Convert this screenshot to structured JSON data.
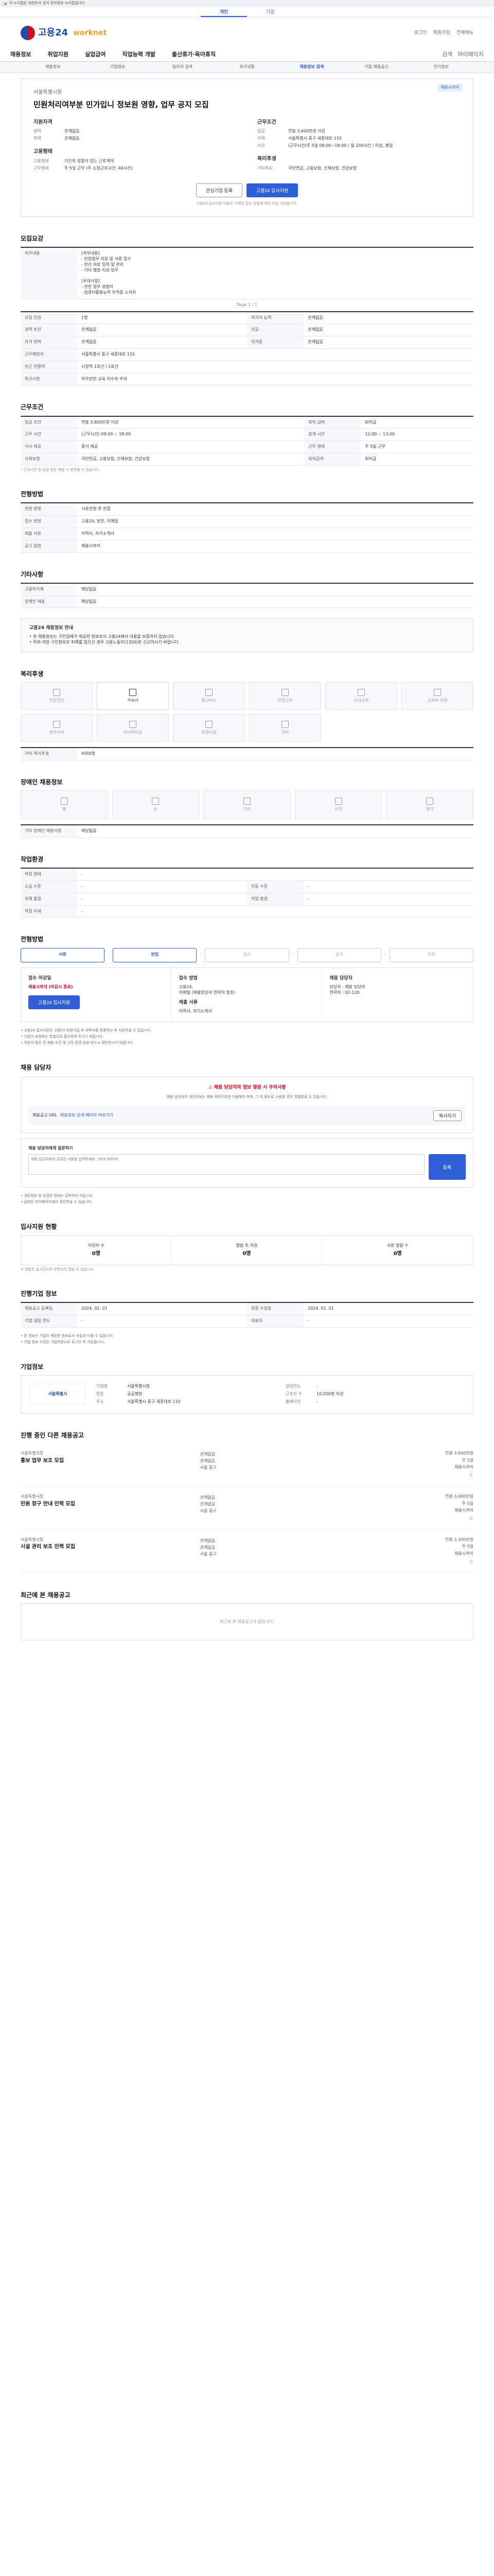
{
  "gov_banner": "이 누리집은 대한민국 공식 전자정부 누리집입니다.",
  "top_tabs": [
    "개인",
    "기업"
  ],
  "logo": {
    "main": "고용24",
    "sub": "worknet"
  },
  "util": [
    "로그인",
    "회원가입",
    "전체메뉴"
  ],
  "gnb": [
    "채용정보",
    "취업지원",
    "실업급여",
    "직업능력 개발",
    "출산휴가·육아휴직"
  ],
  "gnb_right": [
    "검색",
    "마이페이지"
  ],
  "subnav": [
    "채용정보",
    "기업정보",
    "일자리 검색",
    "워크넷통",
    "채용정보 검색",
    "기업 채용공고",
    "인기정보"
  ],
  "posting": {
    "badge": "채용시까지",
    "org": "서울특별시청",
    "title": "민원처리여부분 민가입니 정보원 영향, 업무 공지 모집",
    "sections": {
      "left": [
        {
          "title": "지원자격",
          "rows": [
            [
              "경력",
              "관계없음"
            ],
            [
              "학력",
              "관계없음"
            ]
          ]
        },
        {
          "title": "고용형태",
          "rows": [
            [
              "고용형태",
              "기간의 정함이 있는 근로계약"
            ],
            [
              "근무형태",
              "주 5일 근무 (주 소정근로시간: 40시간)"
            ]
          ]
        }
      ],
      "right": [
        {
          "title": "근무조건",
          "rows": [
            [
              "임금",
              "연봉 3,600만원 이상"
            ],
            [
              "지역",
              "서울특별시 중구 세종대로 110"
            ],
            [
              "시간",
              "(근무시간)주 5일 09:00~18:00 / 월 200시간 / 이상, 평일"
            ]
          ]
        },
        {
          "title": "복리후생",
          "rows": [
            [
              "기타복리",
              "국민연금, 고용보험, 산재보험, 건강보험"
            ]
          ]
        }
      ]
    },
    "buttons": {
      "interest": "관심기업 등록",
      "apply": "고용24 입사지원"
    },
    "notice": "고용24 입사지원 내용은 기재된 접수 방법에 따라 지원 가능합니다."
  },
  "recruit_info": {
    "title": "모집요강",
    "job_desc_label": "직무내용",
    "job_desc": "[직무내용]\n- 민원업무 지원 및 서류 접수\n- 전산 자료 입력 및 관리\n- 기타 행정 지원 업무\n\n[우대사항]\n- 관련 업무 경험자\n- 컴퓨터활용능력 자격증 소지자",
    "pager": "Page 1 / 1",
    "rows": [
      [
        "모집 인원",
        "1명",
        "외국어 능력",
        "관계없음"
      ],
      [
        "경력 조건",
        "관계없음",
        "전공",
        "관계없음"
      ],
      [
        "자격 면허",
        "관계없음",
        "자격증",
        "관계없음"
      ]
    ],
    "address_label": "근무예정지",
    "address": "서울특별시 중구 세종대로 110",
    "nearby_label": "인근 전철역",
    "nearby": "시청역 1호선 / 2호선",
    "notes_label": "특기사항",
    "notes": "직무관련 교육 이수자 우대"
  },
  "work_cond": {
    "title": "근무조건",
    "rows": [
      [
        "임금 조건",
        "연봉 3,600만원 이상",
        "퇴직 급여",
        "퇴직금"
      ],
      [
        "근무 시간",
        "(근무시간) 09:00 ~ 18:00",
        "휴게 시간",
        "12:00 ~ 13:00"
      ],
      [
        "식사 제공",
        "중식 제공",
        "근무 형태",
        "주 5일 근무"
      ],
      [
        "사회보험",
        "국민연금, 고용보험, 산재보험, 건강보험",
        "퇴직급여",
        "퇴직금"
      ]
    ],
    "note": "* 근로시간 및 임금 등은 채용 시 변경될 수 있습니다."
  },
  "apply_method": {
    "title": "전형방법",
    "rows": [
      [
        "전형 방법",
        "서류전형 후 면접"
      ],
      [
        "접수 방법",
        "고용24, 방문, 이메일"
      ],
      [
        "제출 서류",
        "이력서, 자기소개서"
      ],
      [
        "공고 일정",
        "채용시까지"
      ]
    ]
  },
  "etc": {
    "title": "기타사항",
    "rows": [
      [
        "고용허가제",
        "해당없음"
      ],
      [
        "장애인 채용",
        "해당없음"
      ]
    ],
    "alert_title": "고용24 채용정보 안내",
    "alert_lines": [
      "• 본 채용정보는 구인업체가 제공한 정보로서 고용24에서 내용을 보증하지 않습니다.",
      "• 허위·과장 구인정보로 피해를 입으신 경우 고용노동부(1350)로 신고하시기 바랍니다."
    ]
  },
  "welfare": {
    "title": "복리후생",
    "items": [
      "건강검진",
      "기숙사",
      "통근버스",
      "유연근무",
      "사내교육",
      "교육비 지원",
      "경조사비",
      "자녀학자금",
      "휴양시설",
      "기타"
    ],
    "active": [
      1
    ],
    "extra_label": "기타 복리후생",
    "extra": "4대보험"
  },
  "disabled": {
    "title": "장애인 채용정보",
    "items": [
      "팔",
      "손",
      "다리",
      "시각",
      "청각"
    ],
    "extra_label": "기타 장애인 채용사항",
    "extra": "해당없음"
  },
  "workplace": {
    "title": "작업환경",
    "rows": [
      [
        "작업 형태",
        "-",
        "",
        ""
      ],
      [
        "소음 수준",
        "-",
        "진동 수준",
        "-"
      ],
      [
        "유해 물질",
        "-",
        "작업 환경",
        "-"
      ],
      [
        "작업 자세",
        "-",
        "",
        ""
      ]
    ]
  },
  "process": {
    "title": "전형방법",
    "steps": [
      "서류",
      "면접",
      "입사",
      "합격",
      "최종"
    ],
    "active": [
      0,
      1
    ]
  },
  "apply_box": {
    "col1_title": "접수 마감일",
    "col1_deadline": "채용시까지 (마감시 종료)",
    "col1_btn": "고용24 입사지원",
    "col2_title": "접수 방법",
    "col2_lines": [
      "고용24,",
      "이메일 (채용담당자 연락처 참조)"
    ],
    "col2_title2": "제출 서류",
    "col2_lines2": [
      "이력서, 자기소개서"
    ],
    "col3_title": "채용 담당자",
    "col3_lines": [
      "담당자 : 채용 담당자",
      "연락처 : 02-120"
    ],
    "bullets": [
      "• 고용24 입사지원은 고용24 회원가입 후 이력서를 등록하신 후 지원하실 수 있습니다.",
      "• 기업이 요청하는 방법으로 접수하여 주시기 바랍니다.",
      "• 지원서 접수 전 채용 조건 및 근무 환경 등을 반드시 확인하시기 바랍니다."
    ]
  },
  "contact": {
    "title": "채용 담당자",
    "warn_head": "채용 담당자의 정보 열람 시 주의사항",
    "warn_body": "채용 담당자의 개인정보는 채용 목적으로만 이용해야 하며, 그 외 용도로 사용할 경우 처벌받을 수 있습니다.",
    "url_label": "채용공고 URL",
    "url": "채용정보 상세 페이지 바로가기",
    "copy_btn": "복사하기",
    "qa_title": "채용 담당자에게 질문하기",
    "qa_placeholder": "채용 담당자에게 궁금한 내용을 입력하세요. (최대 500자)",
    "qa_btn": "등록",
    "qa_notes": [
      "• 개인정보 등 민감한 정보는 입력하지 마십시오.",
      "• 답변은 마이페이지에서 확인하실 수 있습니다."
    ]
  },
  "status": {
    "title": "입사지원 현황",
    "items": [
      {
        "label": "지원자 수",
        "value": "0명"
      },
      {
        "label": "열람 후 지원",
        "value": "0명"
      },
      {
        "label": "서류 열람 수",
        "value": "0명"
      }
    ],
    "note": "※ 현황은 실시간으로 반영되지 않을 수 있습니다."
  },
  "history": {
    "title": "진행기업 정보",
    "rows": [
      [
        "채용공고 등록일",
        "2024. 01. 01",
        "최종 수정일",
        "2024. 01. 01"
      ],
      [
        "기업 설립 연도",
        "-",
        "대표자",
        "-"
      ]
    ],
    "notes": [
      "• 본 정보는 기업이 제공한 정보로서 사실과 다를 수 있습니다.",
      "• 기업 정보 수정은 기업회원으로 로그인 후 가능합니다."
    ]
  },
  "company": {
    "title": "기업정보",
    "logo_text": "서울특별시",
    "rows": [
      [
        "기업명",
        "서울특별시청"
      ],
      [
        "설립연도",
        "-"
      ],
      [
        "업종",
        "공공행정"
      ],
      [
        "근로자 수",
        "10,000명 이상"
      ],
      [
        "주소",
        "서울특별시 중구 세종대로 110"
      ],
      [
        "홈페이지",
        "-"
      ]
    ]
  },
  "others": {
    "title": "진행 중인 다른 채용공고",
    "items": [
      {
        "org": "서울특별시청",
        "title": "홍보 업무 보조 모집",
        "info": [
          "관계없음",
          "관계없음",
          "서울 중구"
        ],
        "cond": [
          "연봉 3,600만원",
          "주 5일",
          "계약직"
        ],
        "deadline": "채용시까지"
      },
      {
        "org": "서울특별시청",
        "title": "민원 창구 안내 인력 모집",
        "info": [
          "관계없음",
          "관계없음",
          "서울 중구"
        ],
        "cond": [
          "연봉 3,400만원",
          "주 5일",
          "계약직"
        ],
        "deadline": "채용시까지"
      },
      {
        "org": "서울특별시청",
        "title": "시설 관리 보조 인력 모집",
        "info": [
          "관계없음",
          "관계없음",
          "서울 중구"
        ],
        "cond": [
          "연봉 3,300만원",
          "주 5일",
          "계약직"
        ],
        "deadline": "채용시까지"
      }
    ]
  },
  "recent": {
    "title": "최근에 본 채용공고",
    "empty": "최근에 본 채용공고가 없습니다."
  }
}
